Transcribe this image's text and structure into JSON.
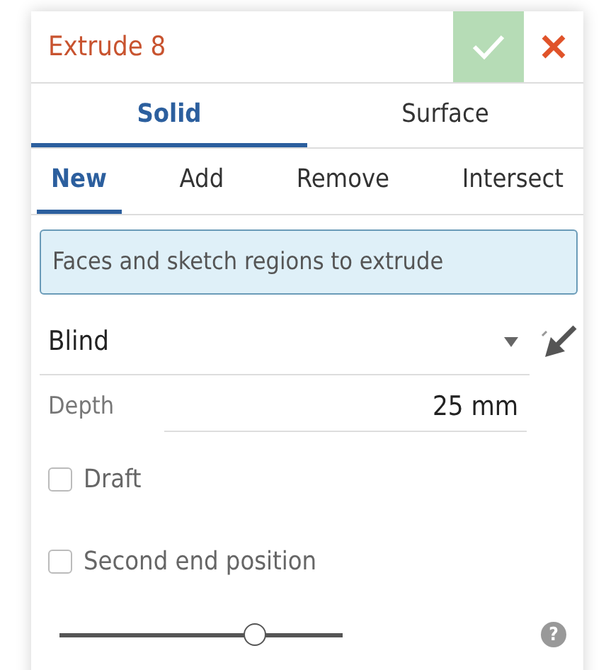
{
  "dialog": {
    "title": "Extrude 8"
  },
  "body_tabs": [
    {
      "label": "Solid",
      "selected": true
    },
    {
      "label": "Surface",
      "selected": false
    }
  ],
  "operation_tabs": [
    {
      "label": "New",
      "selected": true
    },
    {
      "label": "Add",
      "selected": false
    },
    {
      "label": "Remove",
      "selected": false
    },
    {
      "label": "Intersect",
      "selected": false
    }
  ],
  "selection_field": {
    "placeholder": "Faces and sketch regions to extrude",
    "active": true
  },
  "end_type": {
    "value": "Blind"
  },
  "depth": {
    "label": "Depth",
    "value": "25 mm"
  },
  "options": [
    {
      "label": "Draft",
      "checked": false
    },
    {
      "label": "Second end position",
      "checked": false
    }
  ],
  "slider": {
    "level": 0.69
  },
  "help": "?"
}
